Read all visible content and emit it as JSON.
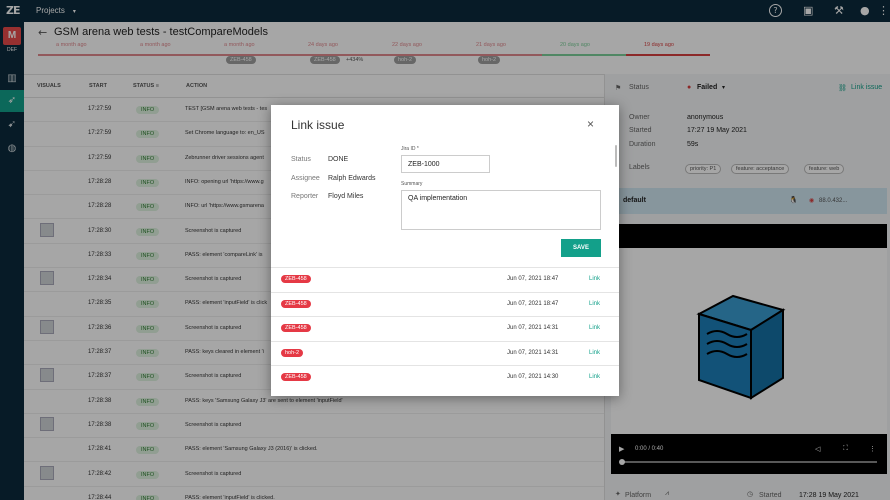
{
  "topbar": {
    "logo": "ZE",
    "projects": "Projects",
    "caret": "▾",
    "help": "?",
    "wallet": "▣",
    "wrench": "⚒",
    "user": "●",
    "more": "⋮"
  },
  "sidebar": {
    "project_initial": "M",
    "project_label": "DEF"
  },
  "header": {
    "back": "←",
    "title": "GSM arena web tests - testCompareModels"
  },
  "history": [
    {
      "label": "a month ago",
      "color": "#e0898e",
      "badge": "",
      "extra": ""
    },
    {
      "label": "a month ago",
      "color": "#e0898e",
      "badge": "",
      "extra": ""
    },
    {
      "label": "a month ago",
      "color": "#e0898e",
      "badge": "ZEB-458",
      "extra": ""
    },
    {
      "label": "24 days ago",
      "color": "#e0898e",
      "badge": "ZEB-458",
      "extra": "+434%"
    },
    {
      "label": "22 days ago",
      "color": "#e0898e",
      "badge": "hoh-2",
      "extra": ""
    },
    {
      "label": "21 days ago",
      "color": "#e0898e",
      "badge": "hoh-2",
      "extra": ""
    },
    {
      "label": "20 days ago",
      "color": "#7ccf9a",
      "badge": "",
      "extra": ""
    },
    {
      "label": "19 days ago",
      "color": "#d84040",
      "badge": "",
      "extra": ""
    }
  ],
  "table": {
    "headers": {
      "visuals": "VISUALS",
      "start": "START",
      "status": "STATUS",
      "action": "ACTION"
    },
    "rows": [
      {
        "time": "17:27:59",
        "status": "INFO",
        "action": "TEST [GSM arena web tests - tes",
        "thumb": false
      },
      {
        "time": "17:27:59",
        "status": "INFO",
        "action": "Set Chrome language to: en_US",
        "thumb": false
      },
      {
        "time": "17:27:59",
        "status": "INFO",
        "action": "Zebrunner driver sessions agent",
        "thumb": false
      },
      {
        "time": "17:28:28",
        "status": "INFO",
        "action": "INFO: opening url 'https://www.g",
        "thumb": false
      },
      {
        "time": "17:28:28",
        "status": "INFO",
        "action": "INFO: url 'https://www.gsmarena",
        "thumb": false
      },
      {
        "time": "17:28:30",
        "status": "INFO",
        "action": "Screenshot is captured",
        "thumb": true
      },
      {
        "time": "17:28:33",
        "status": "INFO",
        "action": "PASS: element 'compareLink' is",
        "thumb": false
      },
      {
        "time": "17:28:34",
        "status": "INFO",
        "action": "Screenshot is captured",
        "thumb": true
      },
      {
        "time": "17:28:35",
        "status": "INFO",
        "action": "PASS: element 'inputField' is click",
        "thumb": false
      },
      {
        "time": "17:28:36",
        "status": "INFO",
        "action": "Screenshot is captured",
        "thumb": true
      },
      {
        "time": "17:28:37",
        "status": "INFO",
        "action": "PASS: keys cleared in element 'i",
        "thumb": false
      },
      {
        "time": "17:28:37",
        "status": "INFO",
        "action": "Screenshot is captured",
        "thumb": true
      },
      {
        "time": "17:28:38",
        "status": "INFO",
        "action": "PASS: keys 'Samsung Galaxy J3' are sent to element 'inputField'",
        "thumb": false
      },
      {
        "time": "17:28:38",
        "status": "INFO",
        "action": "Screenshot is captured",
        "thumb": true
      },
      {
        "time": "17:28:41",
        "status": "INFO",
        "action": "PASS: element 'Samsung Galaxy J3 (2016)' is clicked.",
        "thumb": false
      },
      {
        "time": "17:28:42",
        "status": "INFO",
        "action": "Screenshot is captured",
        "thumb": true
      },
      {
        "time": "17:28:44",
        "status": "INFO",
        "action": "PASS: element 'inputField' is clicked.",
        "thumb": false
      }
    ]
  },
  "details": {
    "status_label": "Status",
    "status_value": "Failed",
    "status_caret": "▾",
    "link_issue": "Link issue",
    "owner_label": "Owner",
    "owner_value": "anonymous",
    "started_label": "Started",
    "started_value": "17:27 19 May 2021",
    "duration_label": "Duration",
    "duration_value": "59s",
    "labels_label": "Labels",
    "tags": [
      "priority: P1",
      "feature: acceptance",
      "feature: web"
    ],
    "config_name": "default",
    "browser_version": "88.0.432...",
    "video_time": "0:00 / 0:40",
    "platform_label": "Platform",
    "started2_label": "Started",
    "started2_value": "17:28 19 May 2021"
  },
  "modal": {
    "title": "Link issue",
    "close": "×",
    "status_label": "Status",
    "status_value": "DONE",
    "assignee_label": "Assignee",
    "assignee_value": "Ralph Edwards",
    "reporter_label": "Reporter",
    "reporter_value": "Floyd Miles",
    "jira_label": "Jira ID *",
    "jira_value": "ZEB-1000",
    "summary_label": "Summary",
    "summary_value": "QA implementation",
    "save_label": "SAVE",
    "issues": [
      {
        "id": "ZEB-458",
        "date": "Jun 07, 2021 18:47",
        "link": "Link"
      },
      {
        "id": "ZEB-458",
        "date": "Jun 07, 2021 18:47",
        "link": "Link"
      },
      {
        "id": "ZEB-458",
        "date": "Jun 07, 2021 14:31",
        "link": "Link"
      },
      {
        "id": "hoh-2",
        "date": "Jun 07, 2021 14:31",
        "link": "Link"
      },
      {
        "id": "ZEB-458",
        "date": "Jun 07, 2021 14:30",
        "link": "Link"
      }
    ]
  },
  "colors": {
    "accent": "#13a08a",
    "danger": "#e53945",
    "nav": "#0b2a3c"
  }
}
